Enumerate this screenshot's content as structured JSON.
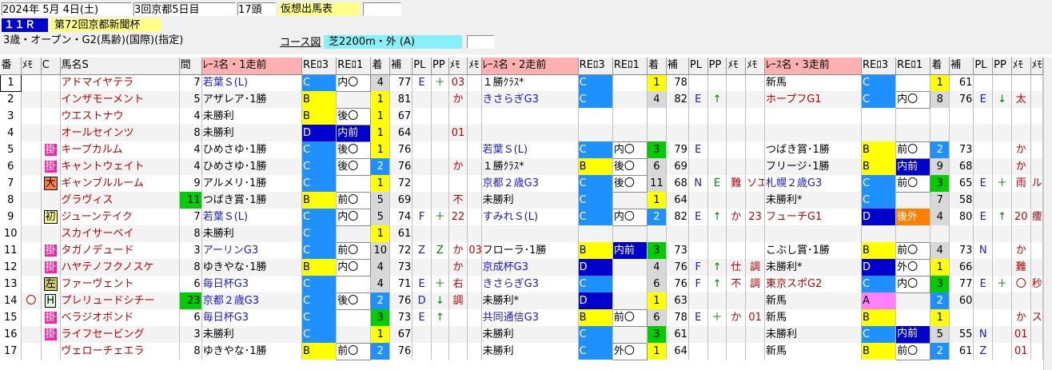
{
  "header": {
    "date": "2024年 5月 4日(土)",
    "meeting": "3回京都5日目",
    "heads": "17頭",
    "card_label": "仮想出馬表",
    "race_no": "１１Ｒ",
    "race_name": "第72回京都新聞杯",
    "conditions": "3歳・オープン・G2(馬齢)(国際)(指定)",
    "course_label": "コース図",
    "course": "芝2200m・外 (A)"
  },
  "columns": [
    "番",
    "ﾒﾓ",
    "C",
    "馬名S",
    "間",
    "ﾚｰｽ名・1走前",
    "REﾛ3",
    "REﾛ1",
    "着",
    "補",
    "PL",
    "PP",
    "ﾒﾓ",
    "ﾒﾓ",
    "ﾚｰｽ名・2走前",
    "REﾛ3",
    "REﾛ1",
    "着",
    "補",
    "PL",
    "PP",
    "ﾒﾓ",
    "ﾒﾓ",
    "ﾚｰｽ名・3走前",
    "REﾛ3",
    "REﾛ1",
    "着",
    "補",
    "PL",
    "PP",
    "ﾒﾓ",
    "ﾒﾓ"
  ],
  "rows": [
    {
      "no": "1",
      "memo": "",
      "c": "",
      "name": "アドマイヤテラ",
      "int": "7",
      "r1": [
        "若葉Ｓ(L)",
        "C",
        "内〇",
        "4",
        "77",
        "E",
        "＋",
        "03",
        ""
      ],
      "r2": [
        "１勝ｸﾗｽ*",
        "C",
        "",
        "1",
        "78",
        "",
        "",
        "",
        ""
      ],
      "r3": [
        "新馬",
        "C",
        "",
        "1",
        "61",
        "",
        "",
        "",
        ""
      ]
    },
    {
      "no": "2",
      "memo": "",
      "c": "",
      "name": "インザモーメント",
      "int": "5",
      "r1": [
        "アザレア･1勝",
        "B",
        "",
        "1",
        "81",
        "",
        "",
        "か",
        ""
      ],
      "r2": [
        "きさらぎG3",
        "C",
        "",
        "4",
        "82",
        "E",
        "↑",
        "",
        ""
      ],
      "r3": [
        "ホープフG1",
        "C",
        "内〇",
        "8",
        "76",
        "E",
        "↓",
        "太",
        ""
      ]
    },
    {
      "no": "3",
      "memo": "",
      "c": "",
      "name": "ウエストナウ",
      "int": "4",
      "r1": [
        "未勝利",
        "B",
        "後〇",
        "1",
        "67",
        "",
        "",
        "",
        ""
      ],
      "r2": [
        "",
        "",
        "",
        "",
        "",
        "",
        "",
        "",
        ""
      ],
      "r3": [
        "",
        "",
        "",
        "",
        "",
        "",
        "",
        "",
        ""
      ]
    },
    {
      "no": "4",
      "memo": "",
      "c": "",
      "name": "オールセインツ",
      "int": "8",
      "r1": [
        "未勝利",
        "D",
        "内前",
        "1",
        "64",
        "",
        "",
        "01",
        ""
      ],
      "r2": [
        "",
        "",
        "",
        "",
        "",
        "",
        "",
        "",
        ""
      ],
      "r3": [
        "",
        "",
        "",
        "",
        "",
        "",
        "",
        "",
        ""
      ]
    },
    {
      "no": "5",
      "memo": "",
      "c": "掛",
      "name": "キープカルム",
      "int": "4",
      "r1": [
        "ひめさゆ･1勝",
        "C",
        "後〇",
        "1",
        "76",
        "",
        "",
        "",
        ""
      ],
      "r2": [
        "若葉Ｓ(L)",
        "C",
        "内〇",
        "3",
        "79",
        "E",
        "",
        "",
        ""
      ],
      "r3": [
        "つばき賞･1勝",
        "B",
        "前〇",
        "2",
        "73",
        "",
        "",
        "か",
        ""
      ]
    },
    {
      "no": "6",
      "memo": "",
      "c": "掛",
      "name": "キャントウェイト",
      "int": "4",
      "r1": [
        "ひめさゆ･1勝",
        "C",
        "後〇",
        "2",
        "76",
        "",
        "",
        "か",
        ""
      ],
      "r2": [
        "１勝ｸﾗｽ*",
        "B",
        "後〇",
        "6",
        "69",
        "",
        "",
        "",
        ""
      ],
      "r3": [
        "フリージ･1勝",
        "B",
        "内前",
        "9",
        "68",
        "",
        "",
        "か",
        ""
      ]
    },
    {
      "no": "7",
      "memo": "",
      "c": "大",
      "name": "ギャンブルルーム",
      "int": "9",
      "r1": [
        "アルメリ･1勝",
        "C",
        "",
        "1",
        "72",
        "",
        "",
        "",
        ""
      ],
      "r2": [
        "京都２歳G3",
        "C",
        "後〇",
        "11",
        "68",
        "N",
        "E",
        "難",
        "ソエ"
      ],
      "r3": [
        "札幌２歳G3",
        "C",
        "前〇",
        "3",
        "65",
        "E",
        "＋",
        "雨",
        "ル"
      ]
    },
    {
      "no": "8",
      "memo": "",
      "c": "",
      "name": "グラヴィス",
      "int": "11",
      "r1": [
        "つばき賞･1勝",
        "B",
        "前〇",
        "5",
        "69",
        "",
        "",
        "不",
        ""
      ],
      "r2": [
        "未勝利",
        "C",
        "",
        "1",
        "64",
        "",
        "",
        "",
        ""
      ],
      "r3": [
        "未勝利*",
        "C",
        "",
        "7",
        "58",
        "",
        "",
        "",
        ""
      ]
    },
    {
      "no": "9",
      "memo": "",
      "c": "初",
      "name": "ジューンテイク",
      "int": "7",
      "r1": [
        "若葉Ｓ(L)",
        "C",
        "内〇",
        "5",
        "74",
        "F",
        "＋",
        "22",
        ""
      ],
      "r2": [
        "すみれＳ(L)",
        "C",
        "内〇",
        "2",
        "82",
        "E",
        "↑",
        "か",
        "23"
      ],
      "r3": [
        "フューチG1",
        "D",
        "後外",
        "4",
        "80",
        "E",
        "↑",
        "20",
        "痩"
      ]
    },
    {
      "no": "10",
      "memo": "",
      "c": "",
      "name": "スカイサーベイ",
      "int": "8",
      "r1": [
        "未勝利",
        "C",
        "",
        "1",
        "61",
        "",
        "",
        "",
        ""
      ],
      "r2": [
        "",
        "",
        "",
        "",
        "",
        "",
        "",
        "",
        ""
      ],
      "r3": [
        "",
        "",
        "",
        "",
        "",
        "",
        "",
        "",
        ""
      ]
    },
    {
      "no": "11",
      "memo": "",
      "c": "掛",
      "name": "タガノデュード",
      "int": "3",
      "r1": [
        "アーリンG3",
        "C",
        "前〇",
        "10",
        "72",
        "Z",
        "Z",
        "か",
        "03"
      ],
      "r2": [
        "フローラ･1勝",
        "B",
        "内前",
        "3",
        "73",
        "",
        "",
        "",
        ""
      ],
      "r3": [
        "こぶし賞･1勝",
        "B",
        "前〇",
        "4",
        "73",
        "N",
        "",
        "か",
        ""
      ]
    },
    {
      "no": "12",
      "memo": "",
      "c": "掛",
      "name": "ハヤテノフクノスケ",
      "int": "8",
      "r1": [
        "ゆきやな･1勝",
        "B",
        "内〇",
        "4",
        "73",
        "",
        "",
        "か",
        ""
      ],
      "r2": [
        "京成杯G3",
        "D",
        "",
        "4",
        "76",
        "F",
        "↑",
        "仕",
        "調"
      ],
      "r3": [
        "未勝利*",
        "D",
        "外〇",
        "1",
        "66",
        "",
        "",
        "難",
        ""
      ]
    },
    {
      "no": "13",
      "memo": "",
      "c": "左",
      "name": "ファーヴェント",
      "int": "6",
      "r1": [
        "毎日杯G3",
        "C",
        "",
        "4",
        "71",
        "E",
        "＋",
        "右",
        ""
      ],
      "r2": [
        "きさらぎG3",
        "C",
        "",
        "6",
        "76",
        "F",
        "↑",
        "不",
        "調"
      ],
      "r3": [
        "東京スポG2",
        "C",
        "内〇",
        "3",
        "77",
        "E",
        "＋",
        "〇",
        "秒"
      ]
    },
    {
      "no": "14",
      "memo": "〇",
      "c": "H",
      "name": "プレリュードシチー",
      "int": "23",
      "r1": [
        "京都２歳G3",
        "C",
        "後〇",
        "2",
        "76",
        "D",
        "↓",
        "調",
        ""
      ],
      "r2": [
        "未勝利*",
        "D",
        "",
        "1",
        "63",
        "",
        "",
        "",
        ""
      ],
      "r3": [
        "新馬",
        "A",
        "",
        "2",
        "60",
        "",
        "",
        "",
        ""
      ]
    },
    {
      "no": "15",
      "memo": "",
      "c": "掛",
      "name": "ベラジオボンド",
      "int": "6",
      "r1": [
        "毎日杯G3",
        "C",
        "",
        "3",
        "73",
        "E",
        "↑",
        "",
        ""
      ],
      "r2": [
        "共同通信G3",
        "B",
        "前〇",
        "6",
        "78",
        "E",
        "＋",
        "か",
        "01"
      ],
      "r3": [
        "新馬",
        "B",
        "",
        "1",
        "",
        "",
        "",
        "か",
        "ス"
      ]
    },
    {
      "no": "16",
      "memo": "",
      "c": "掛",
      "name": "ライフセービング",
      "int": "3",
      "r1": [
        "未勝利",
        "C",
        "",
        "1",
        "67",
        "",
        "",
        "",
        ""
      ],
      "r2": [
        "未勝利",
        "C",
        "",
        "3",
        "61",
        "",
        "",
        "",
        ""
      ],
      "r3": [
        "未勝利",
        "C",
        "内前",
        "5",
        "55",
        "N",
        "",
        "01",
        ""
      ]
    },
    {
      "no": "17",
      "memo": "",
      "c": "",
      "name": "ヴェローチェエラ",
      "int": "8",
      "r1": [
        "ゆきやな･1勝",
        "B",
        "前〇",
        "2",
        "76",
        "",
        "",
        "",
        ""
      ],
      "r2": [
        "未勝利",
        "C",
        "外〇",
        "1",
        "64",
        "",
        "",
        "",
        ""
      ],
      "r3": [
        "新馬",
        "B",
        "前〇",
        "2",
        "61",
        "Z",
        "",
        "01",
        ""
      ]
    }
  ],
  "colors": {
    "rank_C": "#1e90ff",
    "rank_B": "#ffff00",
    "rank_D": "#0000cc",
    "rank_A": "#ff80ff",
    "first": "#ffff00",
    "second": "#1e90ff",
    "third": "#00cc00"
  }
}
